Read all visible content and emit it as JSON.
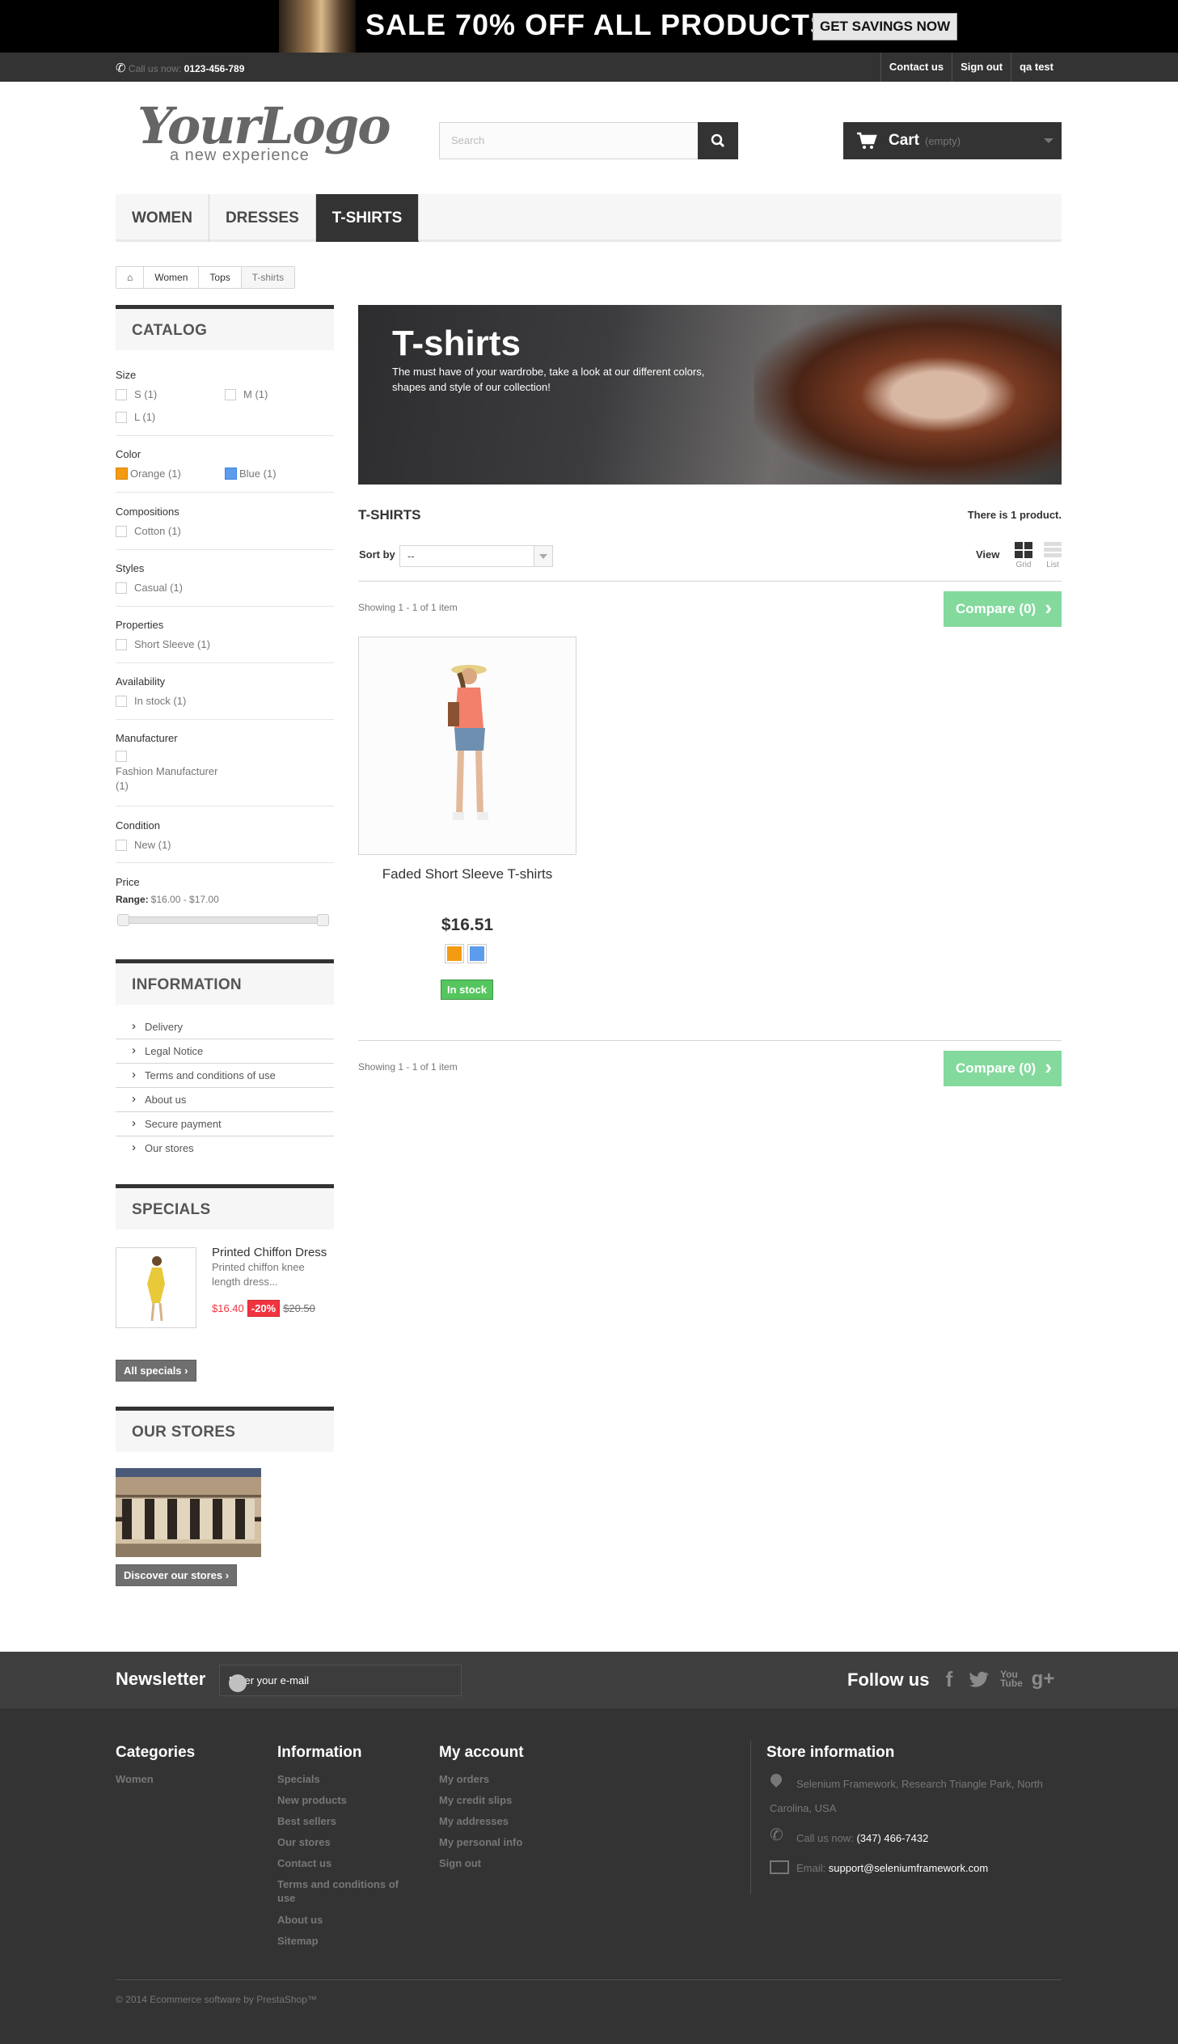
{
  "banner": {
    "sale_text": "SALE 70% OFF ALL PRODUCTS",
    "button": "GET SAVINGS NOW"
  },
  "topnav": {
    "call_label": "Call us now:",
    "phone": "0123-456-789",
    "links": [
      "Contact us",
      "Sign out",
      "qa test"
    ]
  },
  "logo": {
    "big": "YourLogo",
    "small": "a new experience"
  },
  "search": {
    "placeholder": "Search"
  },
  "cart": {
    "label": "Cart",
    "status": "(empty)"
  },
  "menu": [
    "Women",
    "Dresses",
    "T-shirts"
  ],
  "breadcrumb": [
    "Women",
    "Tops",
    "T-shirts"
  ],
  "catalog": {
    "title": "Catalog",
    "size_label": "Size",
    "size_opts": [
      "S (1)",
      "M (1)",
      "L (1)"
    ],
    "color_label": "Color",
    "color_opts": [
      "Orange (1)",
      "Blue (1)"
    ],
    "comp_label": "Compositions",
    "comp_opts": [
      "Cotton (1)"
    ],
    "styles_label": "Styles",
    "styles_opts": [
      "Casual (1)"
    ],
    "props_label": "Properties",
    "props_opts": [
      "Short Sleeve (1)"
    ],
    "avail_label": "Availability",
    "avail_opts": [
      "In stock (1)"
    ],
    "manu_label": "Manufacturer",
    "manu_opts": [
      "Fashion Manufacturer (1)"
    ],
    "cond_label": "Condition",
    "cond_opts": [
      "New (1)"
    ],
    "price_label": "Price",
    "range_label": "Range:",
    "range_value": "$16.00 - $17.00",
    "orange": "#f39c11",
    "blue": "#5d9cec"
  },
  "information": {
    "title": "Information",
    "items": [
      "Delivery",
      "Legal Notice",
      "Terms and conditions of use",
      "About us",
      "Secure payment",
      "Our stores"
    ]
  },
  "specials": {
    "title": "Specials",
    "name": "Printed Chiffon Dress",
    "desc": "Printed chiffon knee length dress...",
    "price": "$16.40",
    "discount": "-20%",
    "old_price": "$20.50",
    "all_button": "All specials"
  },
  "stores": {
    "title": "Our stores",
    "button": "Discover our stores"
  },
  "category": {
    "heading": "T-shirts",
    "desc": "The must have of your wardrobe, take a look at our different colors, shapes and style of our collection!",
    "listing_title": "T-SHIRTS",
    "count": "There is 1 product."
  },
  "toolbar": {
    "sort_label": "Sort by",
    "sort_value": "--",
    "view_label": "View",
    "grid": "Grid",
    "list": "List",
    "showing": "Showing 1 - 1 of 1 item",
    "compare": "Compare (0)"
  },
  "product": {
    "name": "Faded Short Sleeve T-shirts",
    "price": "$16.51",
    "stock": "In stock"
  },
  "newsletter": {
    "title": "Newsletter",
    "placeholder": "Enter your e-mail",
    "follow": "Follow us"
  },
  "footer": {
    "cat_title": "Categories",
    "cat_items": [
      "Women"
    ],
    "info_title": "Information",
    "info_items": [
      "Specials",
      "New products",
      "Best sellers",
      "Our stores",
      "Contact us",
      "Terms and conditions of use",
      "About us",
      "Sitemap"
    ],
    "acct_title": "My account",
    "acct_items": [
      "My orders",
      "My credit slips",
      "My addresses",
      "My personal info",
      "Sign out"
    ],
    "store_title": "Store information",
    "address": "Selenium Framework, Research Triangle Park, North Carolina, USA",
    "call_label": "Call us now:",
    "phone": "(347) 466-7432",
    "email_label": "Email:",
    "email": "support@seleniumframework.com",
    "copyright": "© 2014 Ecommerce software by PrestaShop™"
  }
}
